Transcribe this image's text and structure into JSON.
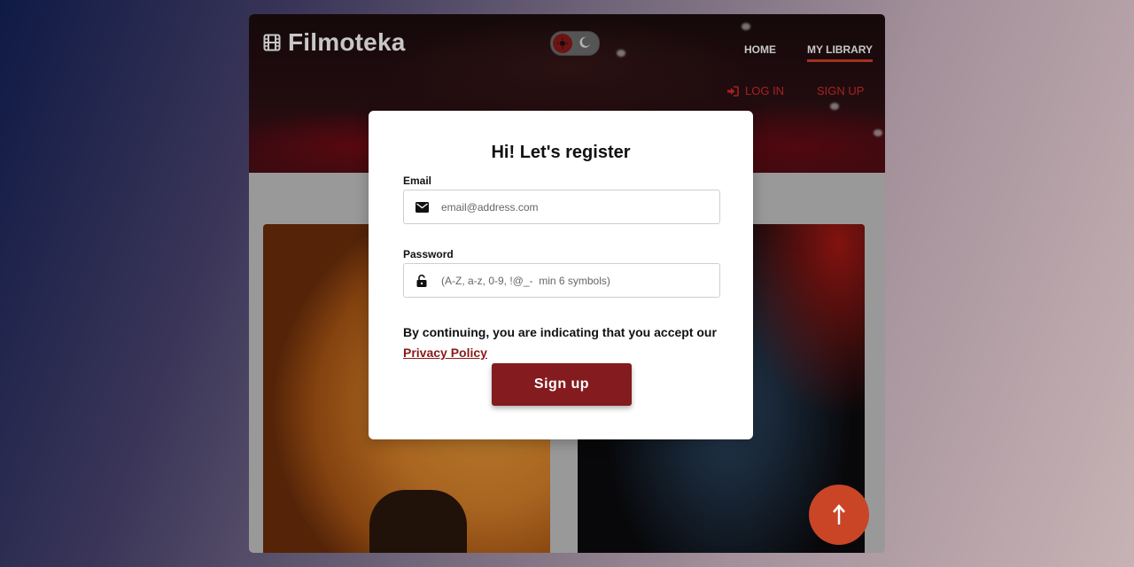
{
  "app": {
    "title": "Filmoteka"
  },
  "nav": {
    "home": "HOME",
    "library": "MY LIBRARY"
  },
  "auth": {
    "login": "LOG IN",
    "signup": "SIGN UP"
  },
  "modal": {
    "title": "Hi! Let's register",
    "email_label": "Email",
    "email_placeholder": "email@address.com",
    "password_label": "Password",
    "password_placeholder": "(A-Z, a-z, 0-9, !@_-  min 6 symbols)",
    "consent_text": "By continuing, you are indicating that you accept our",
    "privacy_link": "Privacy Policy",
    "submit": "Sign up"
  },
  "colors": {
    "accent": "#841c1f",
    "link_red": "#d62b2b",
    "fab": "#c94526",
    "underline": "#d14026"
  },
  "icons": {
    "logo": "film-icon",
    "theme_sun": "sun-icon",
    "theme_moon": "moon-icon",
    "login": "login-icon",
    "email": "envelope-icon",
    "password": "unlock-icon",
    "scroll": "arrow-up-icon"
  }
}
